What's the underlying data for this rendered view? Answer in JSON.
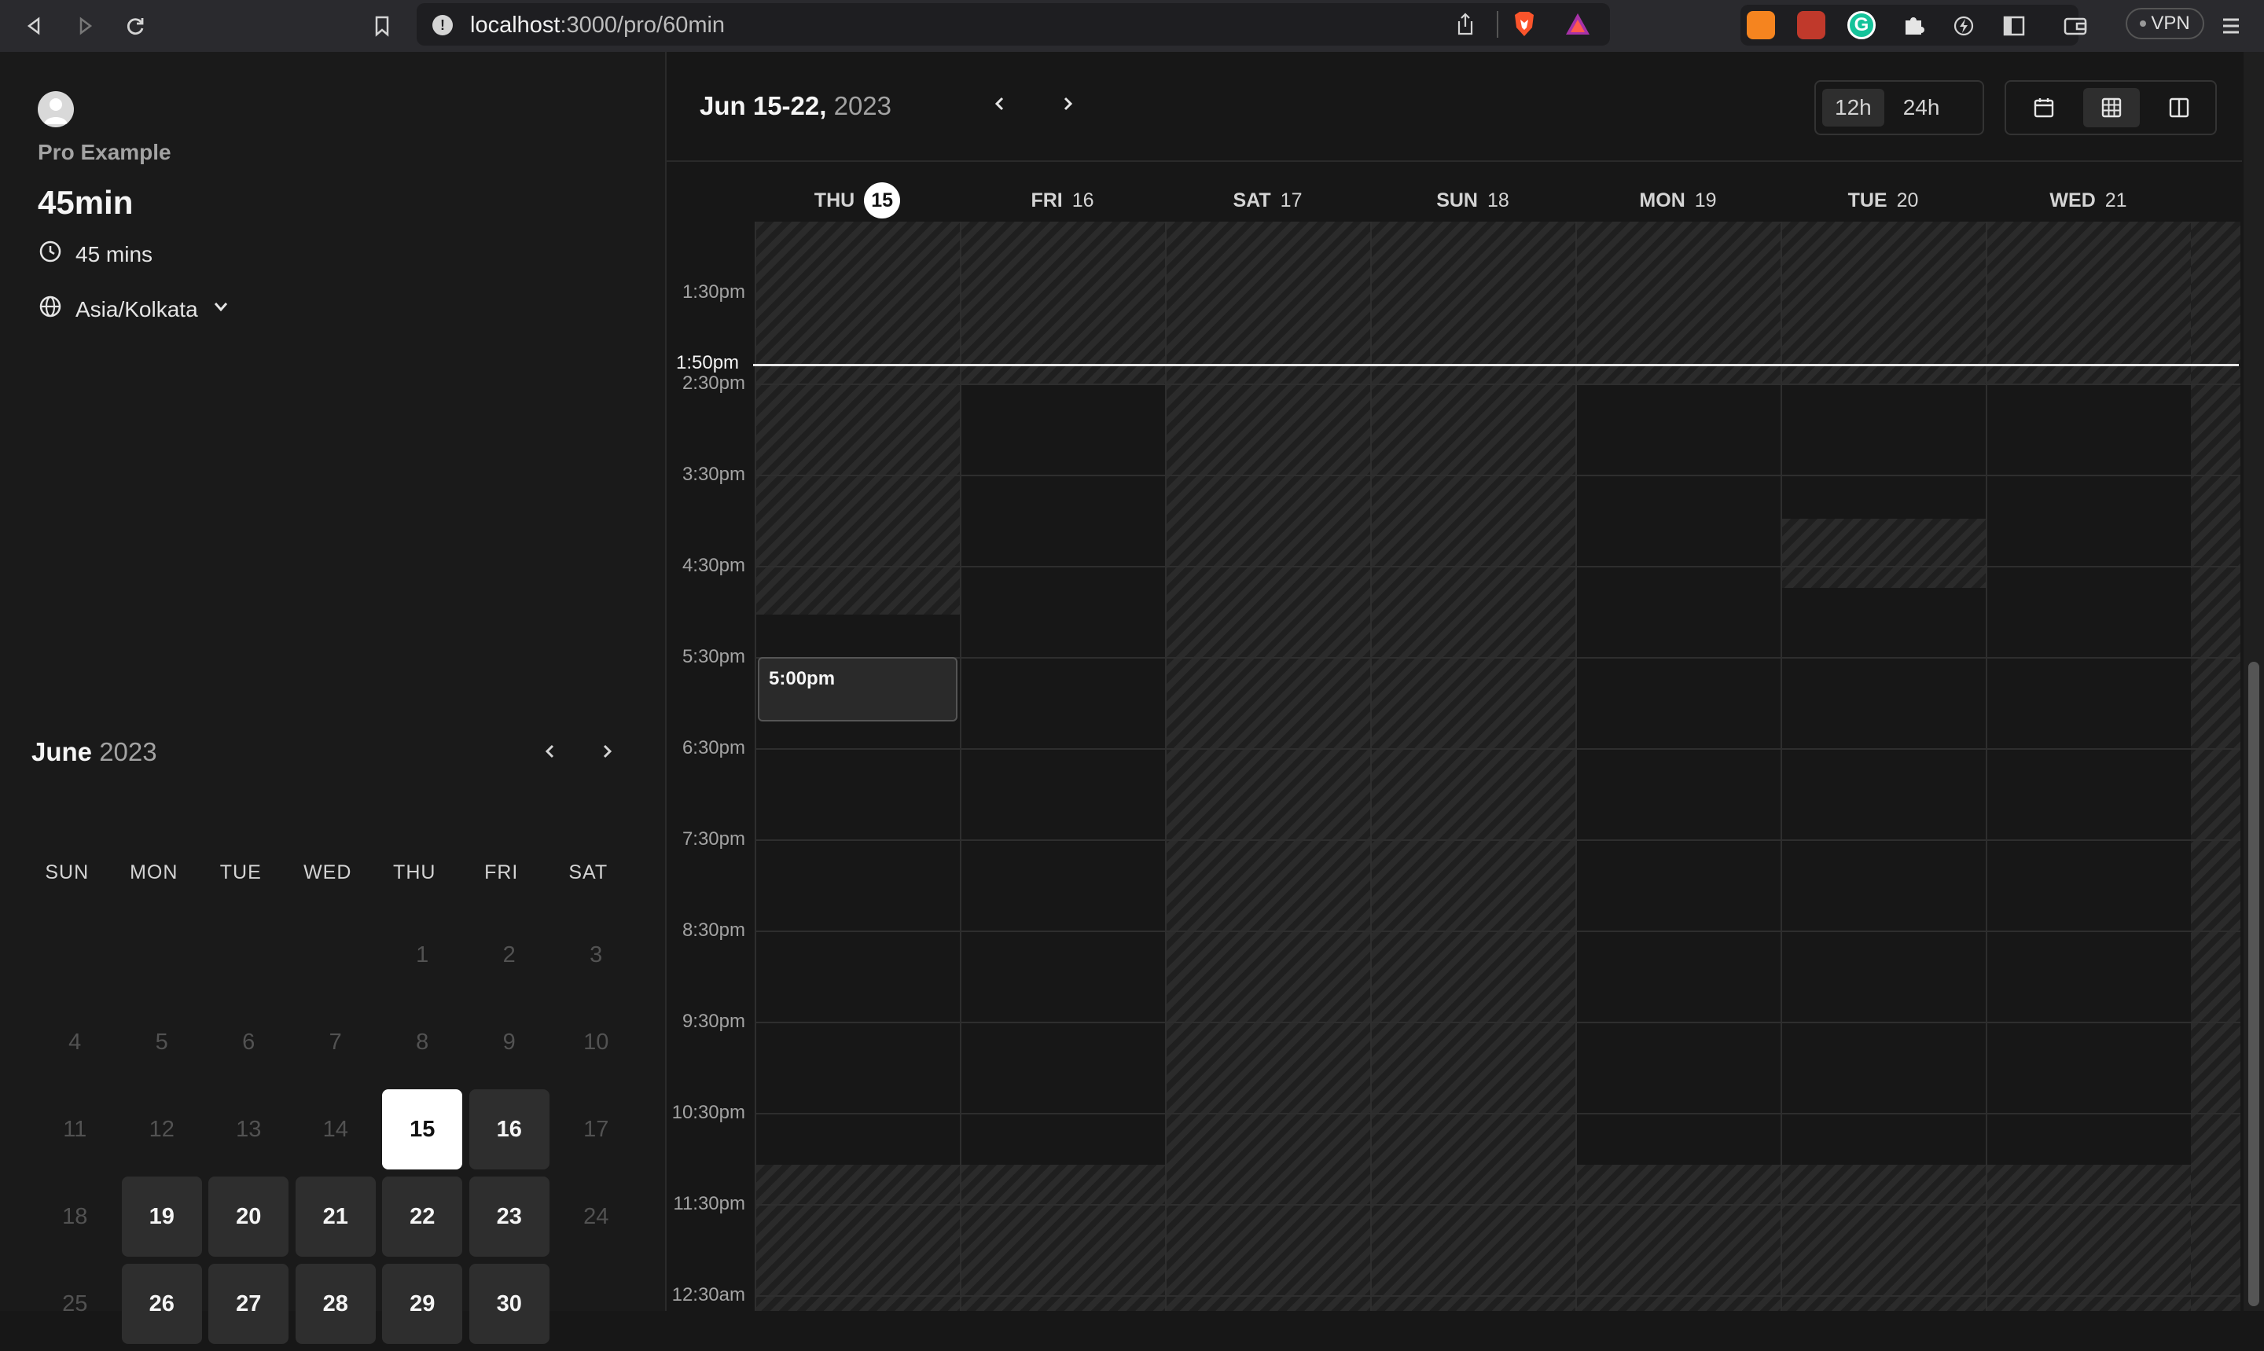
{
  "browser": {
    "url_host": "localhost",
    "url_path": ":3000/pro/60min",
    "vpn_label": "VPN",
    "icons": [
      "back-icon",
      "forward-icon",
      "reload-icon",
      "bookmark-icon",
      "info-icon",
      "share-icon",
      "brave-shield-icon",
      "brave-rewards-icon",
      "metamask-icon",
      "extension-icon",
      "grammarly-icon",
      "puzzle-icon",
      "lightning-icon",
      "sidebar-icon",
      "wallet-icon",
      "menu-icon"
    ]
  },
  "profile": {
    "name": "Pro Example",
    "event_title": "45min",
    "duration": "45 mins",
    "timezone": "Asia/Kolkata"
  },
  "month_calendar": {
    "month": "June",
    "year": "2023",
    "weekdays": [
      "SUN",
      "MON",
      "TUE",
      "WED",
      "THU",
      "FRI",
      "SAT"
    ],
    "leading_blanks": 4,
    "days": [
      {
        "d": "1",
        "state": "off"
      },
      {
        "d": "2",
        "state": "off"
      },
      {
        "d": "3",
        "state": "off"
      },
      {
        "d": "4",
        "state": "off"
      },
      {
        "d": "5",
        "state": "off"
      },
      {
        "d": "6",
        "state": "off"
      },
      {
        "d": "7",
        "state": "off"
      },
      {
        "d": "8",
        "state": "off"
      },
      {
        "d": "9",
        "state": "off"
      },
      {
        "d": "10",
        "state": "off"
      },
      {
        "d": "11",
        "state": "off"
      },
      {
        "d": "12",
        "state": "off"
      },
      {
        "d": "13",
        "state": "off"
      },
      {
        "d": "14",
        "state": "off"
      },
      {
        "d": "15",
        "state": "selected"
      },
      {
        "d": "16",
        "state": "available"
      },
      {
        "d": "17",
        "state": "off"
      },
      {
        "d": "18",
        "state": "off"
      },
      {
        "d": "19",
        "state": "available"
      },
      {
        "d": "20",
        "state": "available"
      },
      {
        "d": "21",
        "state": "available"
      },
      {
        "d": "22",
        "state": "available"
      },
      {
        "d": "23",
        "state": "available"
      },
      {
        "d": "24",
        "state": "off"
      },
      {
        "d": "25",
        "state": "off"
      },
      {
        "d": "26",
        "state": "available"
      },
      {
        "d": "27",
        "state": "available"
      },
      {
        "d": "28",
        "state": "available"
      },
      {
        "d": "29",
        "state": "available"
      },
      {
        "d": "30",
        "state": "available"
      }
    ]
  },
  "week_view": {
    "range": "Jun 15-22,",
    "year": "2023",
    "format_12h": "12h",
    "format_24h": "24h",
    "selected_format": "12h",
    "views": [
      "month-view-icon",
      "week-view-icon",
      "column-view-icon"
    ],
    "selected_view": "week-view-icon",
    "days": [
      {
        "dow": "THU",
        "num": "15",
        "today": true
      },
      {
        "dow": "FRI",
        "num": "16",
        "today": false
      },
      {
        "dow": "SAT",
        "num": "17",
        "today": false
      },
      {
        "dow": "SUN",
        "num": "18",
        "today": false
      },
      {
        "dow": "MON",
        "num": "19",
        "today": false
      },
      {
        "dow": "TUE",
        "num": "20",
        "today": false
      },
      {
        "dow": "WED",
        "num": "21",
        "today": false
      }
    ],
    "time_labels": [
      "1:30pm",
      "2:30pm",
      "3:30pm",
      "4:30pm",
      "5:30pm",
      "6:30pm",
      "7:30pm",
      "8:30pm",
      "9:30pm",
      "10:30pm",
      "11:30pm",
      "12:30am"
    ],
    "now_label": "1:50pm",
    "slot_label": "5:00pm"
  }
}
